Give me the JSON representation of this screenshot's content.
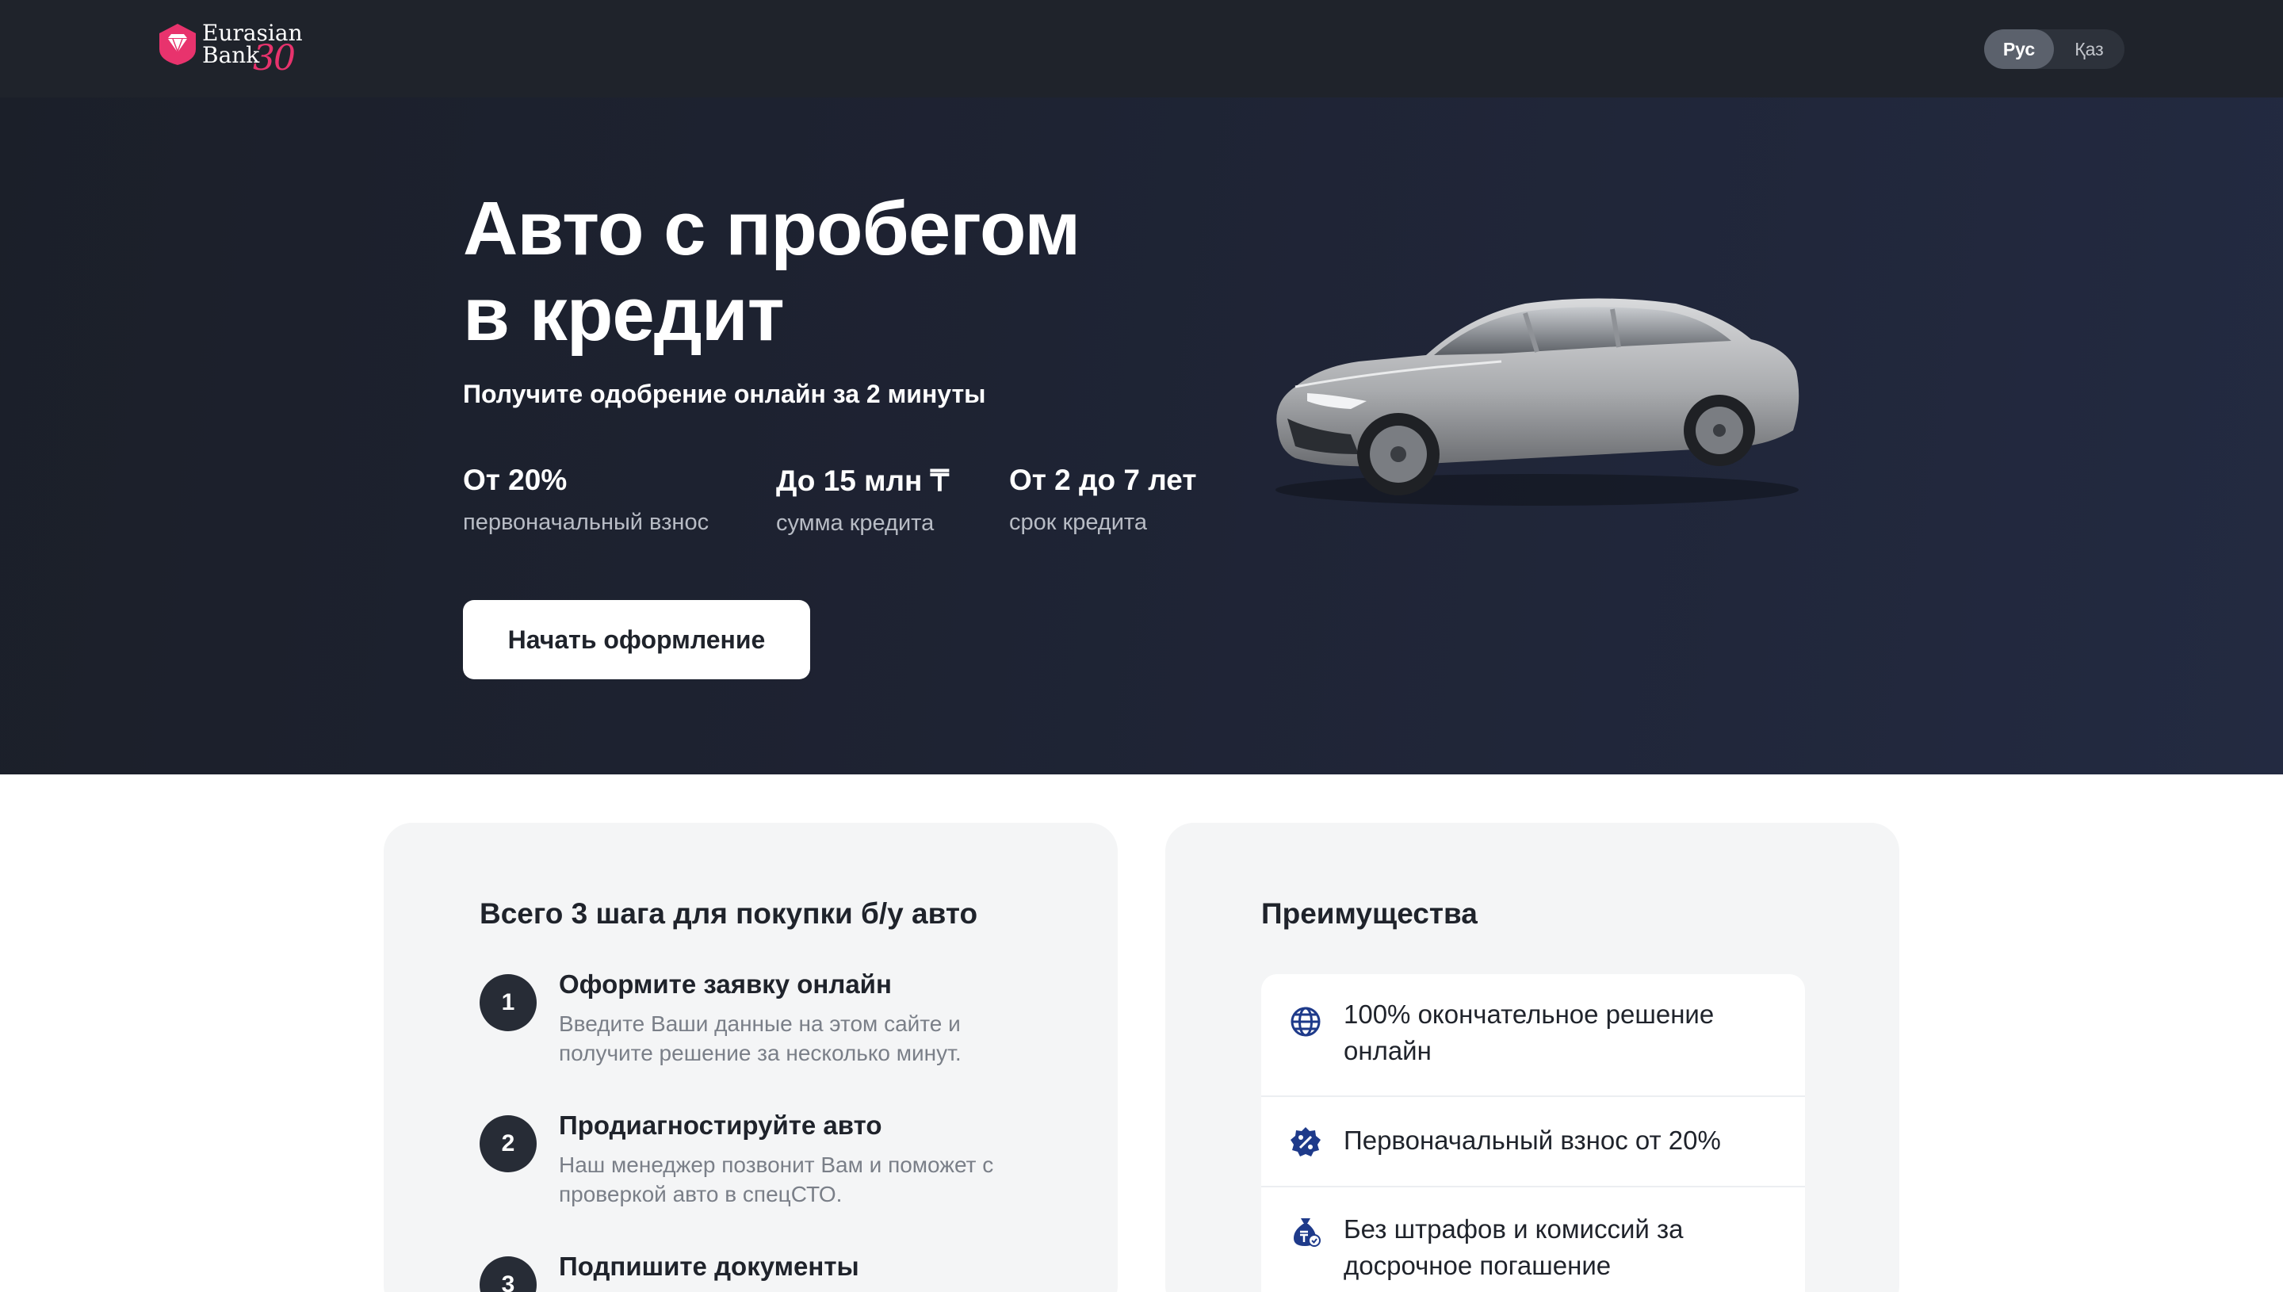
{
  "header": {
    "logo_line1": "Eurasian",
    "logo_line2": "Bank",
    "logo_anniversary": "30",
    "lang_active": "Рус",
    "lang_other": "Қаз"
  },
  "hero": {
    "title_line1": "Авто с пробегом",
    "title_line2": "в кредит",
    "subtitle": "Получите одобрение онлайн за 2 минуты",
    "stats": [
      {
        "value": "От 20%",
        "caption": "первоначальный взнос"
      },
      {
        "value": "До 15 млн ₸",
        "caption": "сумма кредита"
      },
      {
        "value": "От 2 до 7 лет",
        "caption": "срок кредита"
      }
    ],
    "cta_label": "Начать оформление"
  },
  "steps_card": {
    "title": "Всего 3 шага для покупки б/у авто",
    "steps": [
      {
        "number": "1",
        "title": "Оформите заявку онлайн",
        "desc": "Введите Ваши данные на этом сайте и получите решение за несколько минут."
      },
      {
        "number": "2",
        "title": "Продиагностируйте авто",
        "desc": "Наш менеджер позвонит Вам и поможет с проверкой авто в спецСТО."
      },
      {
        "number": "3",
        "title": "Подпишите документы",
        "desc": ""
      }
    ]
  },
  "advantages_card": {
    "title": "Преимущества",
    "items": [
      {
        "icon": "globe-icon",
        "text": "100% окончательное решение онлайн"
      },
      {
        "icon": "percent-badge-icon",
        "text": "Первоначальный взнос от 20%"
      },
      {
        "icon": "money-bag-icon",
        "text": "Без штрафов и комиссий за досрочное погашение"
      }
    ]
  },
  "colors": {
    "header_bg": "#1f232b",
    "hero_bg_start": "#1b1f29",
    "hero_bg_end": "#232a41",
    "brand_pink": "#e8336d",
    "icon_blue": "#1e3a8a",
    "card_bg": "#f4f5f6"
  }
}
